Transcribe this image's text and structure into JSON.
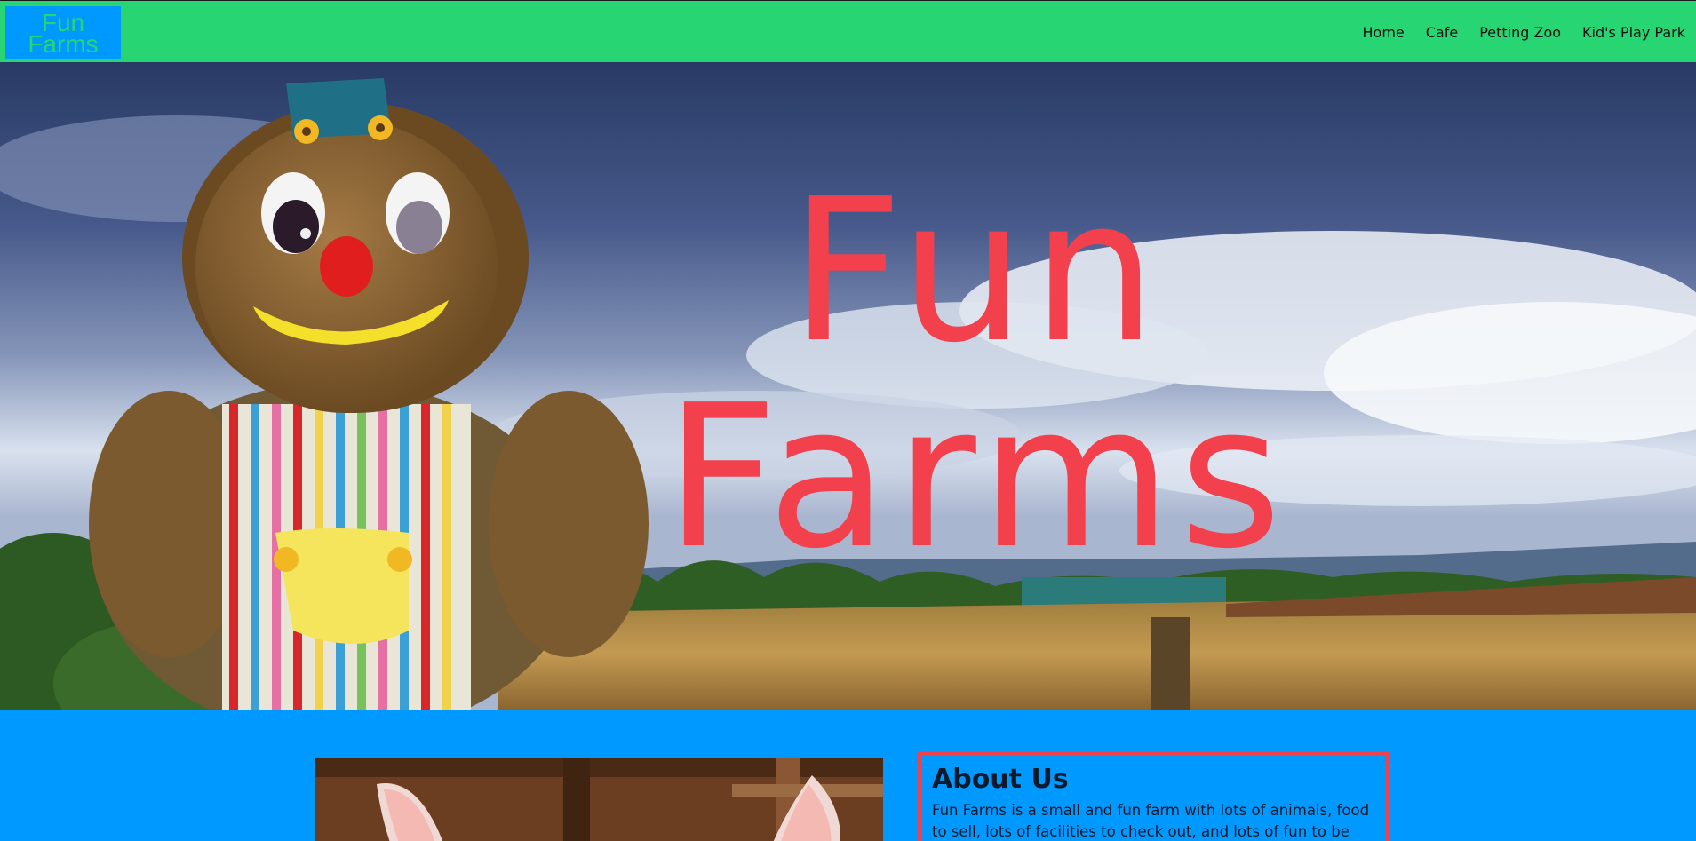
{
  "brand": {
    "logo_line1": "Fun",
    "logo_line2": "Farms",
    "colors": {
      "nav_green": "#27d672",
      "blue": "#0099ff",
      "red": "#f2404d"
    }
  },
  "nav": {
    "items": [
      {
        "label": "Home"
      },
      {
        "label": "Cafe"
      },
      {
        "label": "Petting Zoo"
      },
      {
        "label": "Kid's Play Park"
      }
    ]
  },
  "hero": {
    "title_line1": "Fun",
    "title_line2": "Farms"
  },
  "about": {
    "heading": "About Us",
    "text": "Fun Farms is a small and fun farm with lots of animals, food to sell, lots of facilities to check out, and lots of fun to be had. We are so"
  }
}
